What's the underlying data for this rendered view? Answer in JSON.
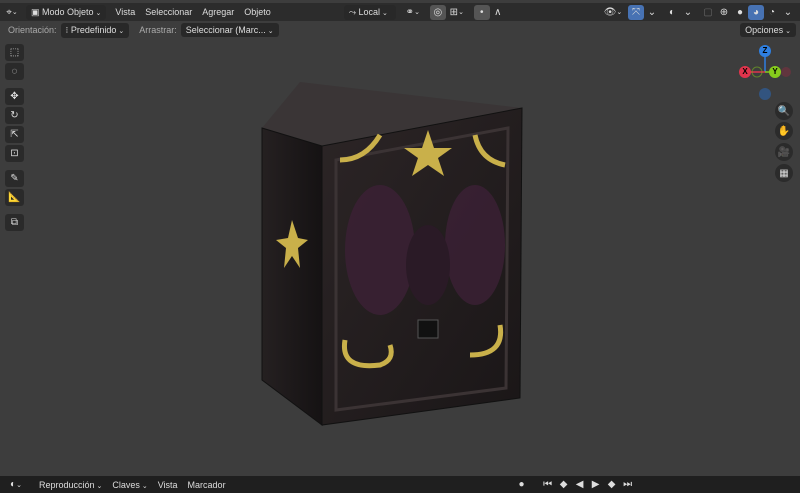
{
  "header": {
    "mode": "Modo Objeto",
    "menus": [
      "Vista",
      "Seleccionar",
      "Agregar",
      "Objeto"
    ],
    "transform_orientation": "Local"
  },
  "tool_header": {
    "orientation_label": "Orientación:",
    "orientation_value": "Predefinido",
    "drag_label": "Arrastrar:",
    "drag_value": "Seleccionar (Marc...",
    "options": "Opciones"
  },
  "gizmo": {
    "z": "Z",
    "x": "X",
    "y": "Y"
  },
  "timeline": {
    "menus": [
      "Reproducción",
      "Claves",
      "Vista",
      "Marcador"
    ]
  },
  "colors": {
    "accent": "#4772b3",
    "x_axis": "#e0344c",
    "y_axis": "#86cc1c",
    "z_axis": "#2f7fe0"
  }
}
